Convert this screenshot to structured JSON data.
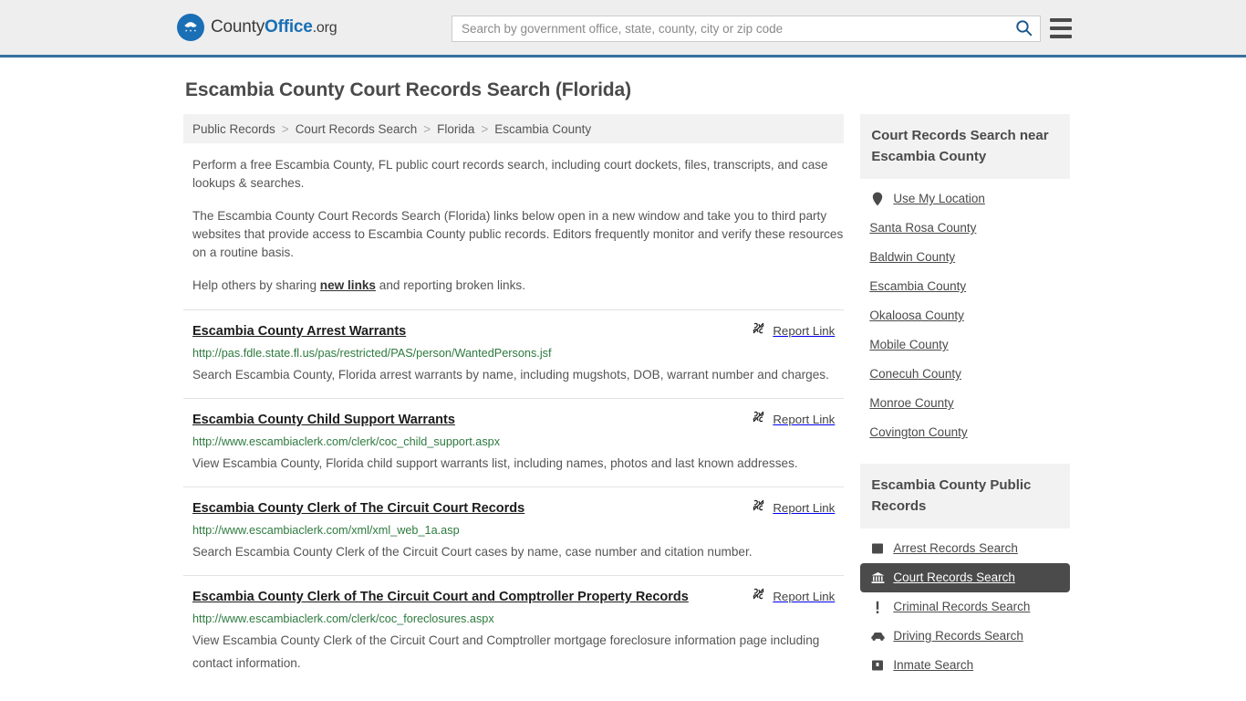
{
  "header": {
    "logo": {
      "icon": "eagle-stars-icon",
      "text_1": "County",
      "text_2": "Office",
      "text_3": ".org"
    },
    "search": {
      "placeholder": "Search by government office, state, county, city or zip code",
      "value": "",
      "button_icon": "search-icon"
    },
    "menu_icon": "hamburger-menu-icon",
    "accent_color": "#36719f"
  },
  "page_title": "Escambia County Court Records Search (Florida)",
  "breadcrumb": {
    "separator": ">",
    "items": [
      {
        "label": "Public Records",
        "current": false
      },
      {
        "label": "Court Records Search",
        "current": false
      },
      {
        "label": "Florida",
        "current": false
      },
      {
        "label": "Escambia County",
        "current": true
      }
    ]
  },
  "intro": {
    "p1": "Perform a free Escambia County, FL public court records search, including court dockets, files, transcripts, and case lookups & searches.",
    "p2": "The Escambia County Court Records Search (Florida) links below open in a new window and take you to third party websites that provide access to Escambia County public records. Editors frequently monitor and verify these resources on a routine basis.",
    "p3_before": "Help others by sharing ",
    "p3_link": "new links",
    "p3_after": " and reporting broken links."
  },
  "report_link": {
    "label": "Report Link",
    "icon": "broken-link-icon"
  },
  "results": [
    {
      "title": "Escambia County Arrest Warrants",
      "url": "http://pas.fdle.state.fl.us/pas/restricted/PAS/person/WantedPersons.jsf",
      "description": "Search Escambia County, Florida arrest warrants by name, including mugshots, DOB, warrant number and charges."
    },
    {
      "title": "Escambia County Child Support Warrants",
      "url": "http://www.escambiaclerk.com/clerk/coc_child_support.aspx",
      "description": "View Escambia County, Florida child support warrants list, including names, photos and last known addresses."
    },
    {
      "title": "Escambia County Clerk of The Circuit Court Records",
      "url": "http://www.escambiaclerk.com/xml/xml_web_1a.asp",
      "description": "Search Escambia County Clerk of the Circuit Court cases by name, case number and citation number."
    },
    {
      "title": "Escambia County Clerk of The Circuit Court and Comptroller Property Records",
      "url": "http://www.escambiaclerk.com/clerk/coc_foreclosures.aspx",
      "description": "View Escambia County Clerk of the Circuit Court and Comptroller mortgage foreclosure information page including contact information."
    }
  ],
  "sidebar": {
    "nearby": {
      "heading": "Court Records Search near Escambia County",
      "items": [
        {
          "label": "Use My Location",
          "icon": "map-pin-icon"
        },
        {
          "label": "Santa Rosa County",
          "icon": ""
        },
        {
          "label": "Baldwin County",
          "icon": ""
        },
        {
          "label": "Escambia County",
          "icon": ""
        },
        {
          "label": "Okaloosa County",
          "icon": ""
        },
        {
          "label": "Mobile County",
          "icon": ""
        },
        {
          "label": "Conecuh County",
          "icon": ""
        },
        {
          "label": "Monroe County",
          "icon": ""
        },
        {
          "label": "Covington County",
          "icon": ""
        }
      ]
    },
    "public_records": {
      "heading": "Escambia County Public Records",
      "items": [
        {
          "label": "Arrest Records Search",
          "icon": "fingerprint-card-icon",
          "active": false
        },
        {
          "label": "Court Records Search",
          "icon": "courthouse-icon",
          "active": true
        },
        {
          "label": "Criminal Records Search",
          "icon": "exclamation-icon",
          "active": false
        },
        {
          "label": "Driving Records Search",
          "icon": "car-icon",
          "active": false
        },
        {
          "label": "Inmate Search",
          "icon": "jail-door-icon",
          "active": false
        }
      ],
      "active_background": "#4b4b4b"
    }
  }
}
